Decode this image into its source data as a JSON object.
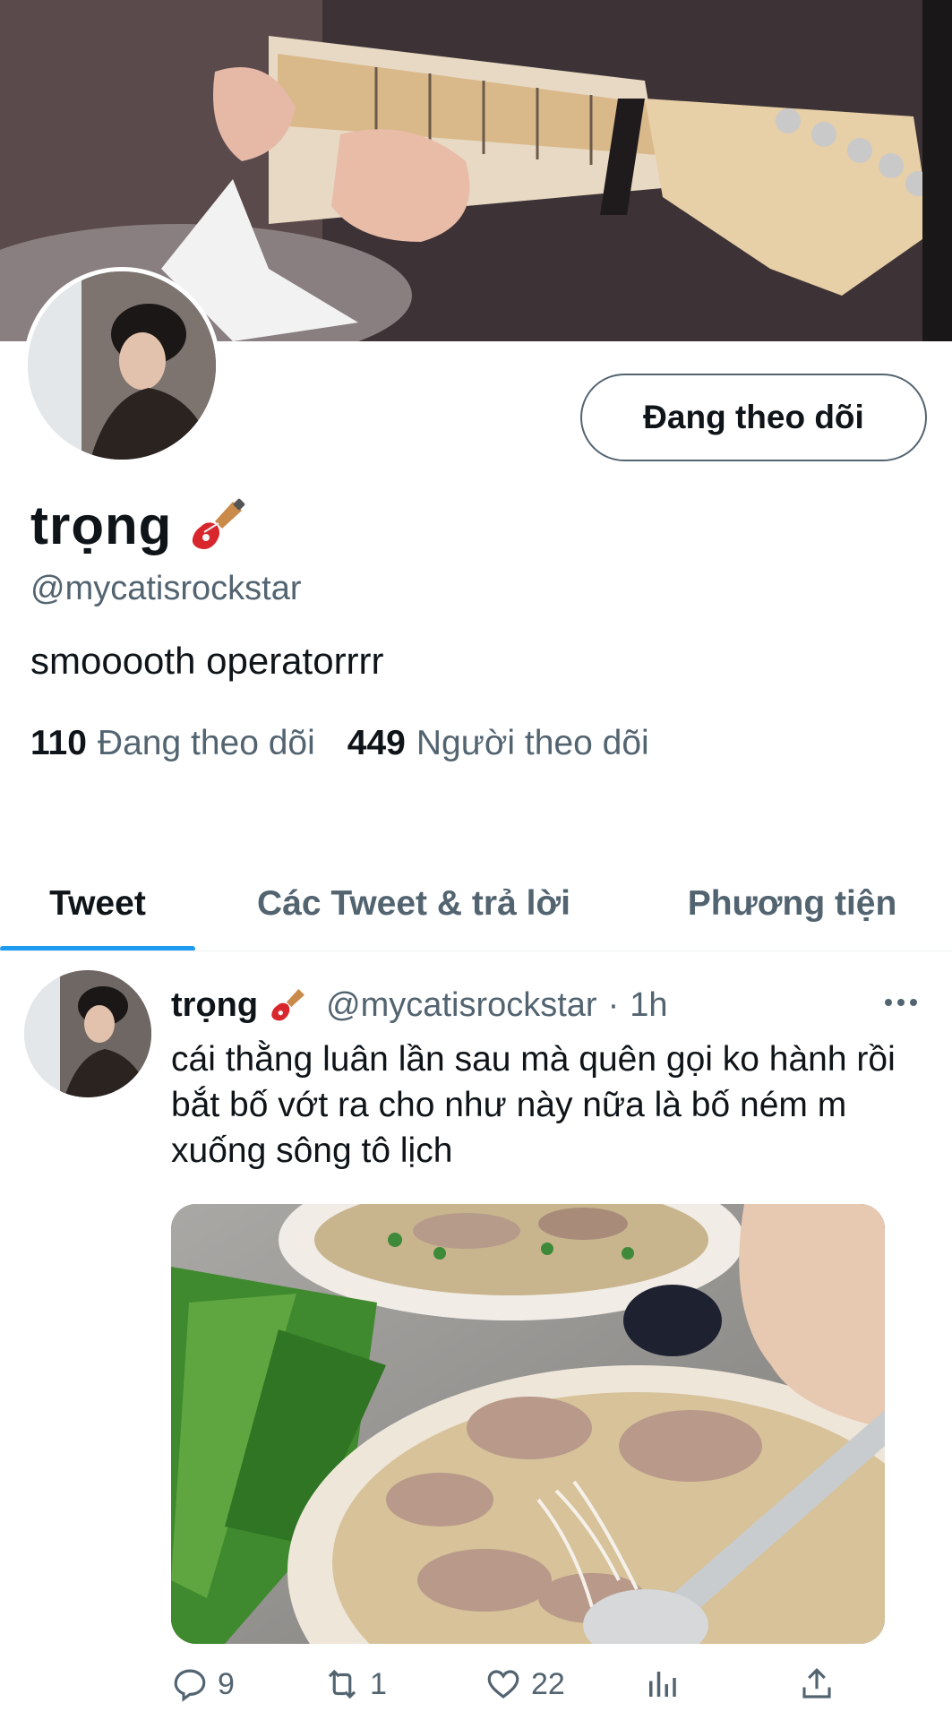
{
  "profile": {
    "display_name": "trọng",
    "handle": "@mycatisrockstar",
    "bio": "smooooth operatorrrr",
    "follow_button_label": "Đang theo dõi",
    "following_count": "110",
    "following_label": "Đang theo dõi",
    "followers_count": "449",
    "followers_label": "Người theo dõi"
  },
  "tabs": [
    {
      "label": "Tweet",
      "active": true
    },
    {
      "label": "Các Tweet & trả lời",
      "active": false
    },
    {
      "label": "Phương tiện",
      "active": false
    }
  ],
  "tweet": {
    "author_name": "trọng",
    "author_handle": "@mycatisrockstar",
    "separator": "·",
    "time": "1h",
    "text": "cái thằng luân lần sau mà quên gọi ko hành rồi bắt bố vớt ra cho như này nữa là bố ném m xuống sông tô lịch",
    "actions": {
      "replies": "9",
      "retweets": "1",
      "likes": "22"
    }
  },
  "icons": {
    "name_emoji": "electric-guitar-icon",
    "more": "more-horizontal-icon",
    "reply": "reply-icon",
    "retweet": "retweet-icon",
    "like": "heart-icon",
    "analytics": "analytics-icon",
    "share": "share-icon"
  },
  "colors": {
    "accent": "#1d9bf0",
    "secondary_text": "#536471",
    "primary_text": "#0f1419"
  }
}
